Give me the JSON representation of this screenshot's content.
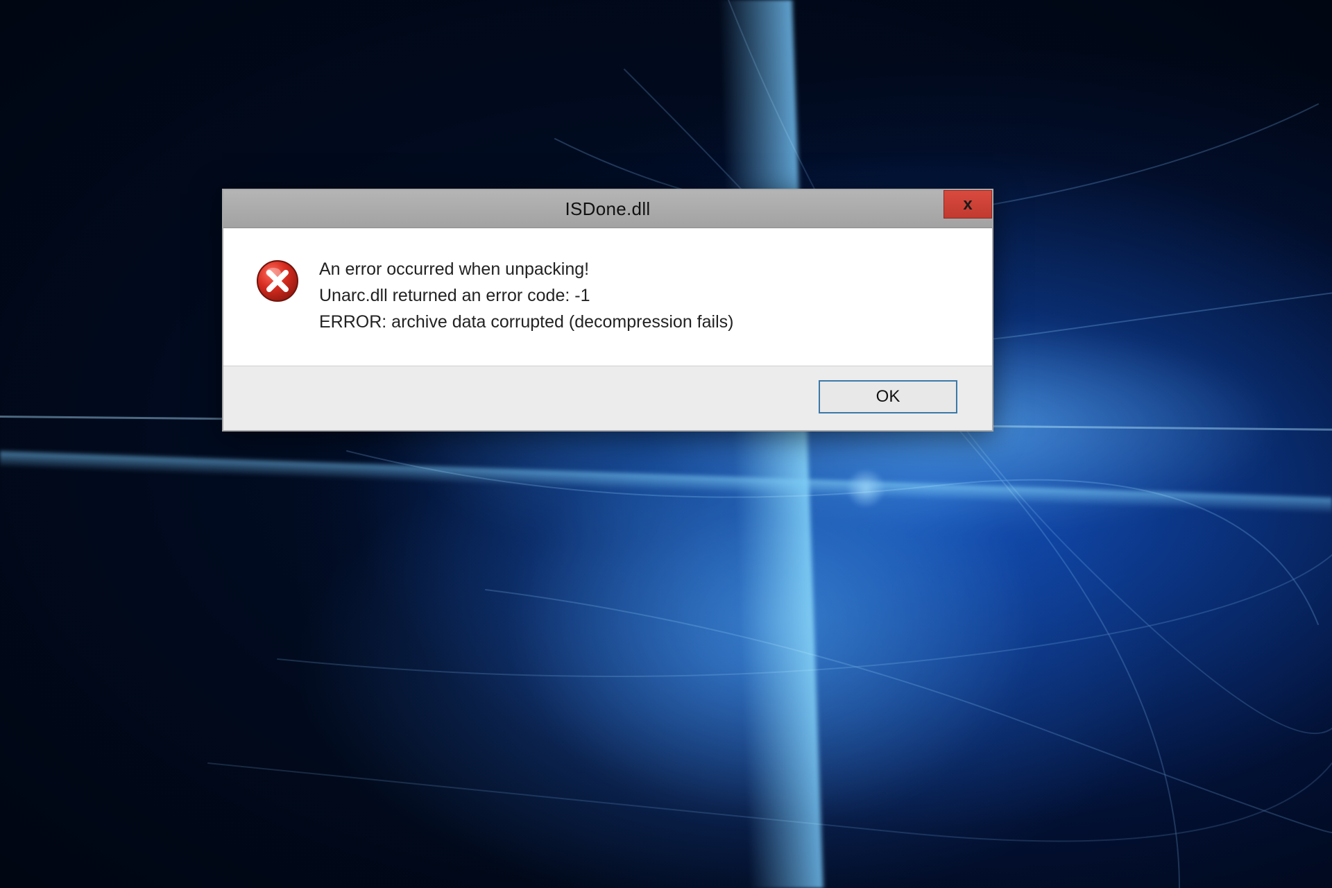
{
  "dialog": {
    "title": "ISDone.dll",
    "close_glyph": "x",
    "message": {
      "line1": "An error occurred when unpacking!",
      "line2": "Unarc.dll returned an error code: -1",
      "line3": "ERROR: archive data corrupted (decompression fails)"
    },
    "ok_label": "OK"
  }
}
